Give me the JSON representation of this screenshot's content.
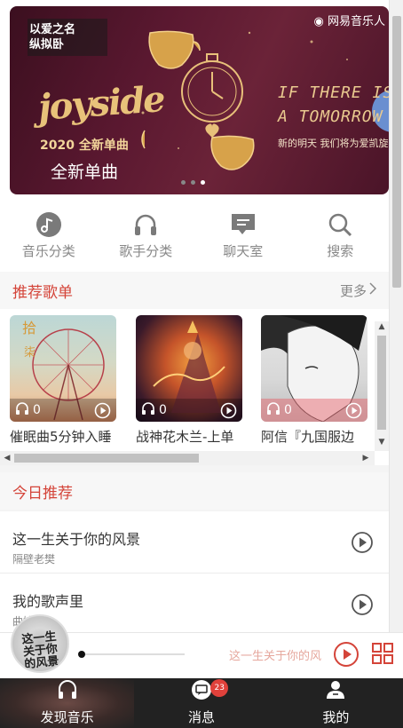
{
  "banner": {
    "brand": "网易音乐人",
    "tag_line1": "以爱之名",
    "tag_line2": "纵拟卧",
    "logo_text": "joyside",
    "year_line": "2020 全新单曲",
    "slogan_en": "IF THERE IS\nA TOMORROW",
    "slogan_cn": "新的明天 我们将为爱凯旋",
    "caption": "全新单曲",
    "dots": 3,
    "active_dot": 3
  },
  "shortcuts": [
    {
      "label": "音乐分类",
      "icon": "music-note-icon"
    },
    {
      "label": "歌手分类",
      "icon": "headphones-icon"
    },
    {
      "label": "聊天室",
      "icon": "chat-icon"
    },
    {
      "label": "搜索",
      "icon": "search-icon"
    }
  ],
  "recommend": {
    "title": "推荐歌单",
    "more": "更多",
    "playlists": [
      {
        "name": "催眠曲5分钟入睡",
        "plays": "0"
      },
      {
        "name": "战神花木兰-上单",
        "plays": "0"
      },
      {
        "name": "阿信『九国服边",
        "plays": "0"
      }
    ]
  },
  "today": {
    "title": "今日推荐",
    "songs": [
      {
        "name": "这一生关于你的风景",
        "artist": "隔壁老樊"
      },
      {
        "name": "我的歌声里",
        "artist": "曲婉婷"
      }
    ]
  },
  "player": {
    "disc_text": "这一生关于你的风景",
    "now_playing": "这一生关于你的风景",
    "progress": 0
  },
  "tabbar": {
    "tabs": [
      {
        "label": "发现音乐",
        "icon": "headphones-icon",
        "active": true
      },
      {
        "label": "消息",
        "icon": "message-icon",
        "badge": "23"
      },
      {
        "label": "我的",
        "icon": "user-icon"
      }
    ]
  },
  "colors": {
    "accent": "#d44439",
    "tabbar": "#222222",
    "muted": "#888888"
  }
}
